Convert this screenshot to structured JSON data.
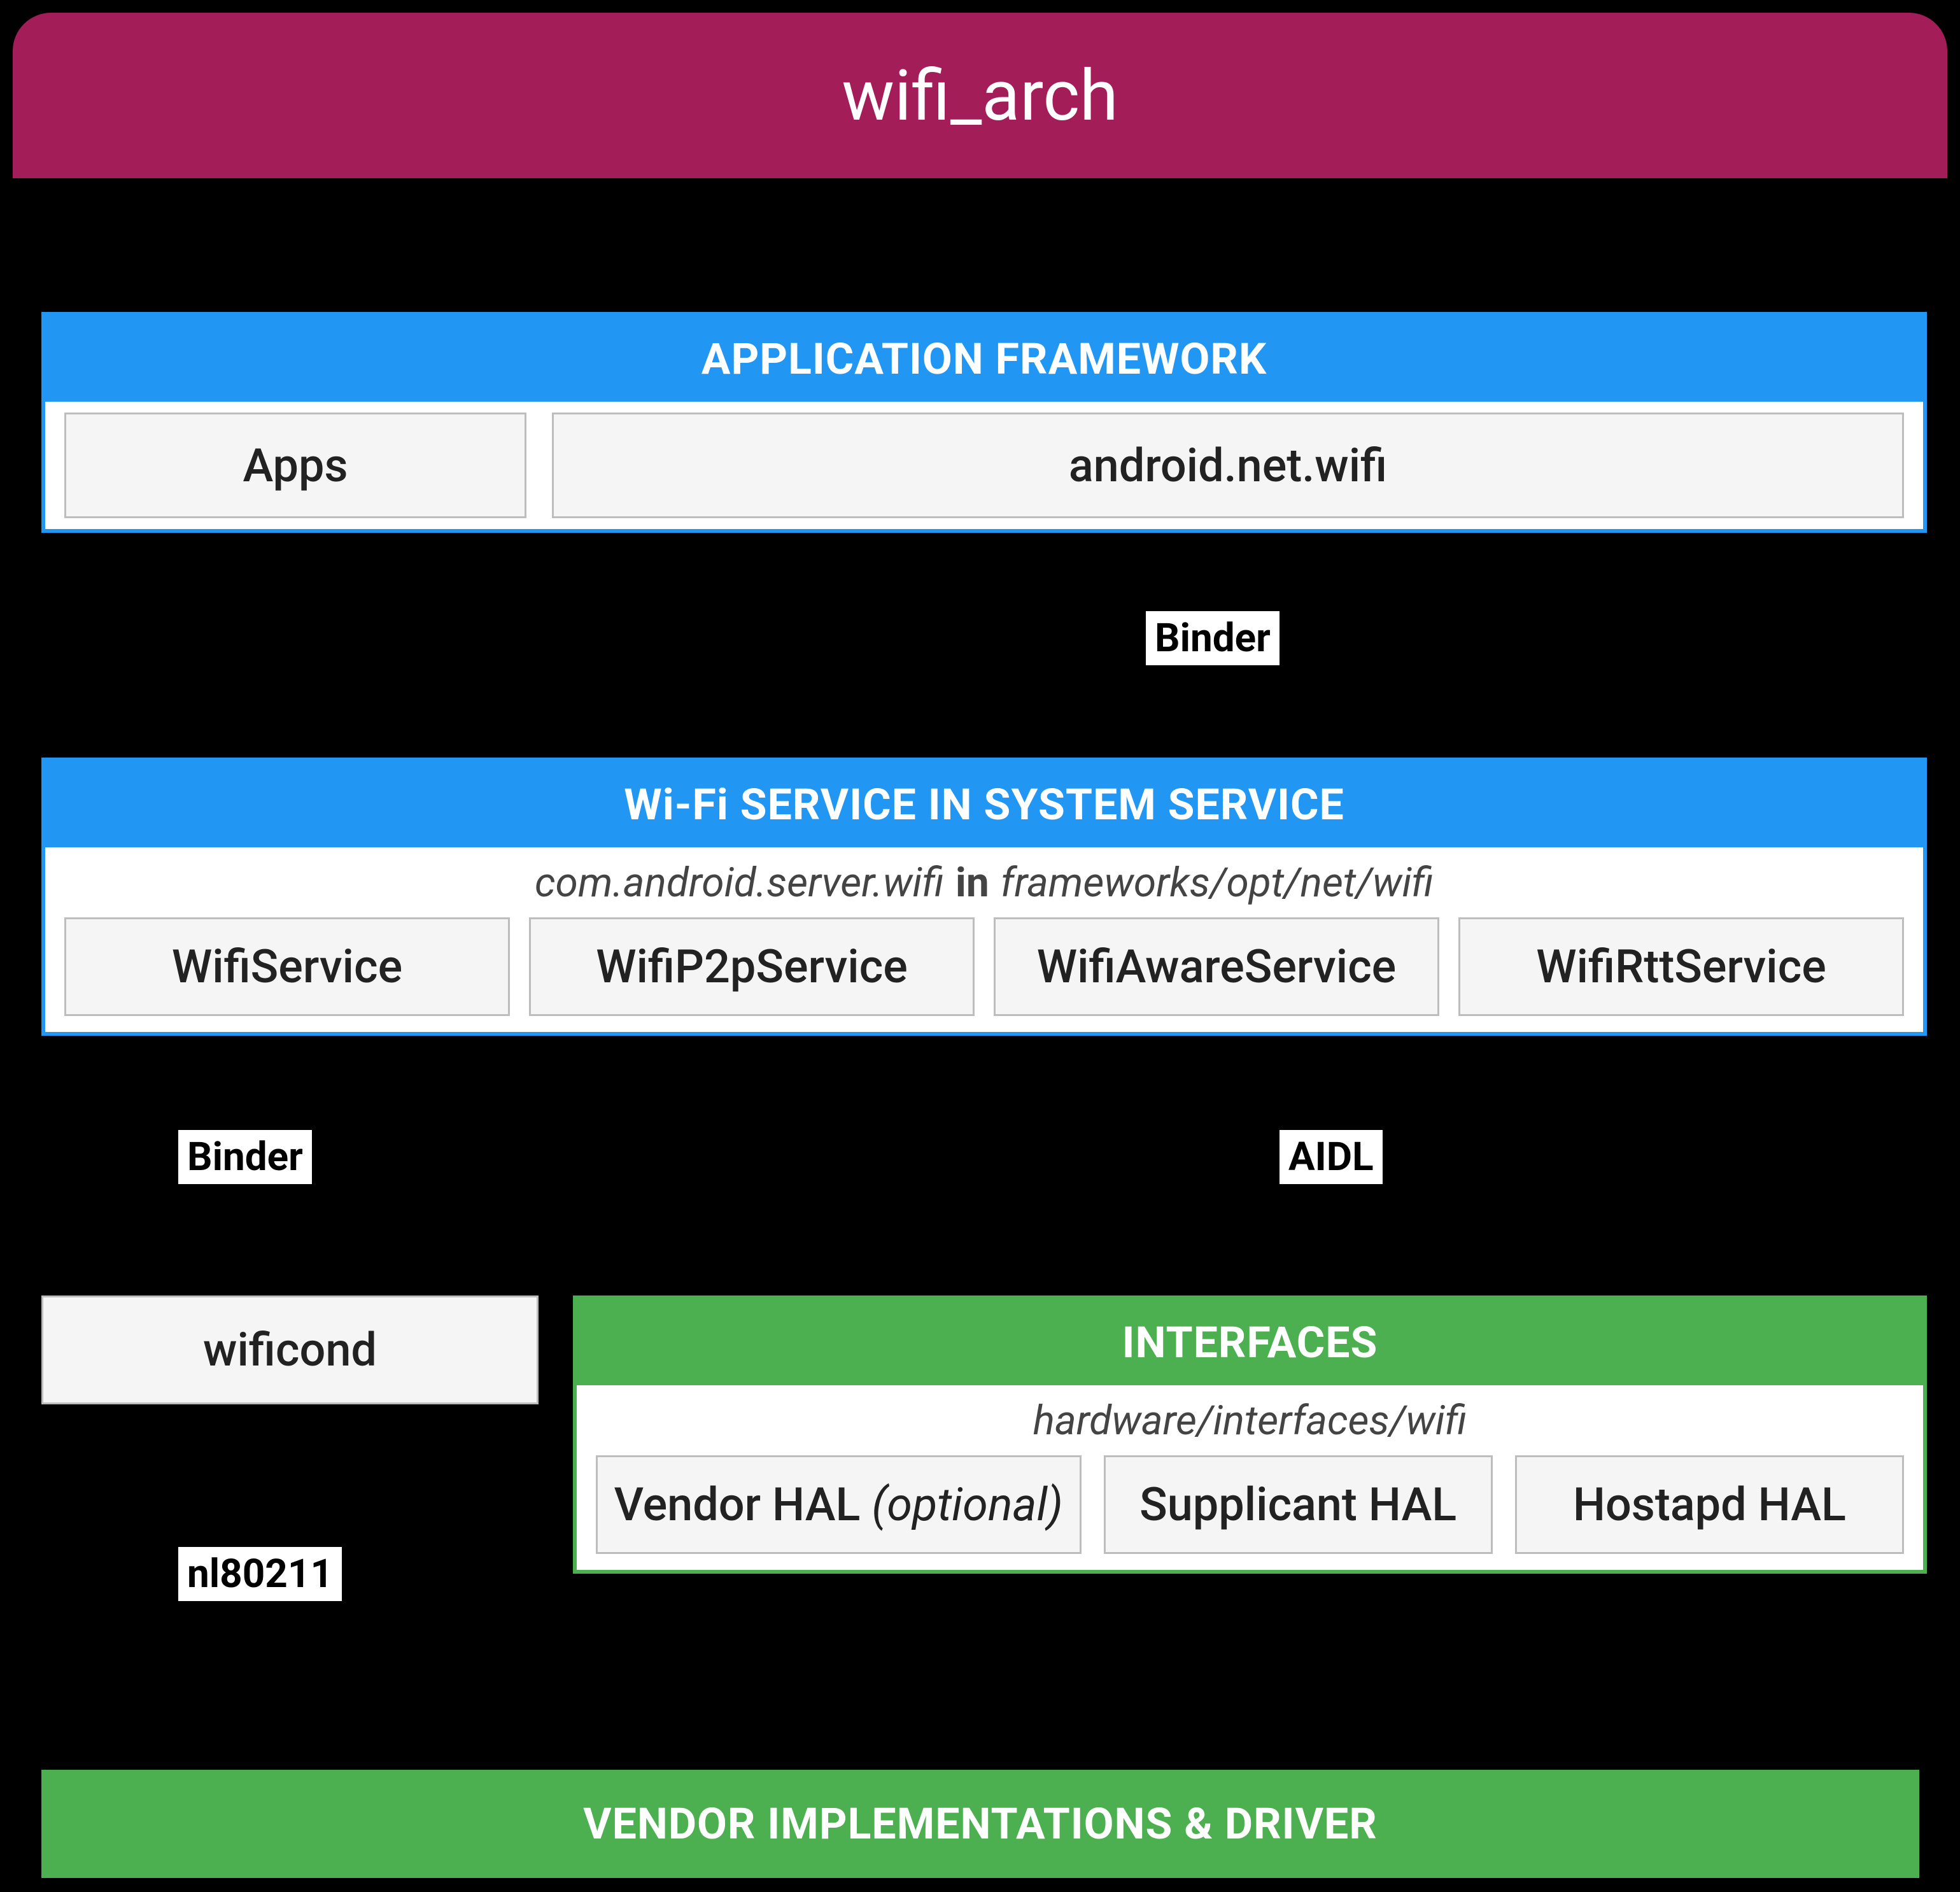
{
  "title": "wifi_arch",
  "application_framework": {
    "header": "APPLICATION FRAMEWORK",
    "apps": "Apps",
    "api": "android.net.wifi"
  },
  "edge_af_ss": "Binder",
  "system_service": {
    "header": "Wi-Fi SERVICE IN SYSTEM SERVICE",
    "subtitle_pkg": "com.android.server.wifi",
    "subtitle_in": "in",
    "subtitle_path": "frameworks/opt/net/wifi",
    "services": [
      "WifiService",
      "WifiP2pService",
      "WifiAwareService",
      "WifiRttService"
    ]
  },
  "edge_ss_wificond": "Binder",
  "edge_ss_if": "AIDL",
  "wificond": "wificond",
  "edge_wificond_vendor": "nl80211",
  "interfaces": {
    "header": "INTERFACES",
    "subtitle": "hardware/interfaces/wifi",
    "hal_vendor": "Vendor HAL",
    "hal_vendor_note": "(optional)",
    "hal_supplicant": "Supplicant HAL",
    "hal_hostapd": "Hostapd HAL"
  },
  "vendor": "VENDOR IMPLEMENTATIONS & DRIVER"
}
